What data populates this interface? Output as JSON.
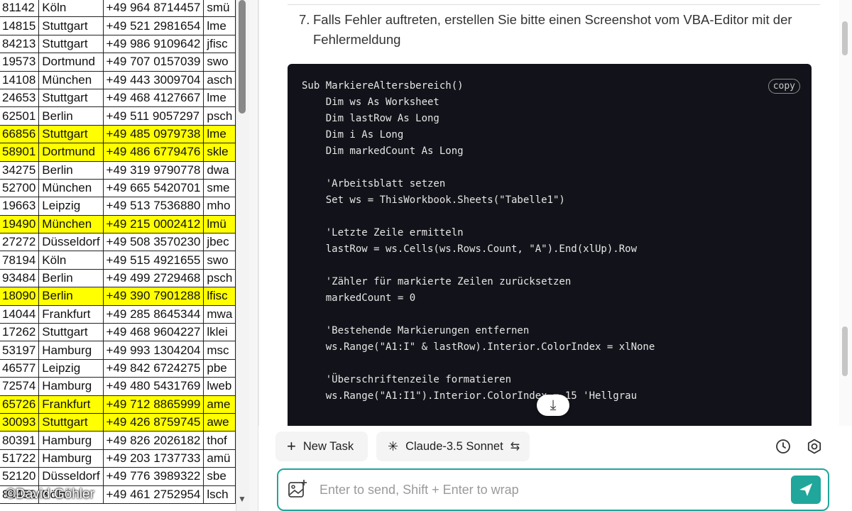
{
  "sheet": {
    "rows": [
      {
        "plz": "81142",
        "city": "Köln",
        "phone": "+49 964 8714457",
        "mail": "smü",
        "highlight": false
      },
      {
        "plz": "14815",
        "city": "Stuttgart",
        "phone": "+49 521 2981654",
        "mail": "lme",
        "highlight": false
      },
      {
        "plz": "84213",
        "city": "Stuttgart",
        "phone": "+49 986 9109642",
        "mail": "jfisc",
        "highlight": false
      },
      {
        "plz": "19573",
        "city": "Dortmund",
        "phone": "+49 707 0157039",
        "mail": "swo",
        "highlight": false
      },
      {
        "plz": "14108",
        "city": "München",
        "phone": "+49 443 3009704",
        "mail": "asch",
        "highlight": false
      },
      {
        "plz": "24653",
        "city": "Stuttgart",
        "phone": "+49 468 4127667",
        "mail": "lme",
        "highlight": false
      },
      {
        "plz": "62501",
        "city": "Berlin",
        "phone": "+49 511 9057297",
        "mail": "psch",
        "highlight": false
      },
      {
        "plz": "66856",
        "city": "Stuttgart",
        "phone": "+49 485 0979738",
        "mail": "lme",
        "highlight": true
      },
      {
        "plz": "58901",
        "city": "Dortmund",
        "phone": "+49 486 6779476",
        "mail": "skle",
        "highlight": true
      },
      {
        "plz": "34275",
        "city": "Berlin",
        "phone": "+49 319 9790778",
        "mail": "dwa",
        "highlight": false
      },
      {
        "plz": "52700",
        "city": "München",
        "phone": "+49 665 5420701",
        "mail": "sme",
        "highlight": false
      },
      {
        "plz": "19663",
        "city": "Leipzig",
        "phone": "+49 513 7536880",
        "mail": "mho",
        "highlight": false
      },
      {
        "plz": "19490",
        "city": "München",
        "phone": "+49 215 0002412",
        "mail": "lmü",
        "highlight": true
      },
      {
        "plz": "27272",
        "city": "Düsseldorf",
        "phone": "+49 508 3570230",
        "mail": "jbec",
        "highlight": false
      },
      {
        "plz": "78194",
        "city": "Köln",
        "phone": "+49 515 4921655",
        "mail": "swo",
        "highlight": false
      },
      {
        "plz": "93484",
        "city": "Berlin",
        "phone": "+49 499 2729468",
        "mail": "psch",
        "highlight": false
      },
      {
        "plz": "18090",
        "city": "Berlin",
        "phone": "+49 390 7901288",
        "mail": "lfisc",
        "highlight": true
      },
      {
        "plz": "14044",
        "city": "Frankfurt",
        "phone": "+49 285 8645344",
        "mail": "mwa",
        "highlight": false
      },
      {
        "plz": "17262",
        "city": "Stuttgart",
        "phone": "+49 468 9604227",
        "mail": "lklei",
        "highlight": false
      },
      {
        "plz": "53197",
        "city": "Hamburg",
        "phone": "+49 993 1304204",
        "mail": "msc",
        "highlight": false
      },
      {
        "plz": "46577",
        "city": "Leipzig",
        "phone": "+49 842 6724275",
        "mail": "pbe",
        "highlight": false
      },
      {
        "plz": "72574",
        "city": "Hamburg",
        "phone": "+49 480 5431769",
        "mail": "lweb",
        "highlight": false
      },
      {
        "plz": "65726",
        "city": "Frankfurt",
        "phone": "+49 712 8865999",
        "mail": "ame",
        "highlight": true
      },
      {
        "plz": "30093",
        "city": "Stuttgart",
        "phone": "+49 426 8759745",
        "mail": "awe",
        "highlight": true
      },
      {
        "plz": "80391",
        "city": "Hamburg",
        "phone": "+49 826 2026182",
        "mail": "thof",
        "highlight": false
      },
      {
        "plz": "51722",
        "city": "Hamburg",
        "phone": "+49 203 1737733",
        "mail": "amü",
        "highlight": false
      },
      {
        "plz": "52120",
        "city": "Düsseldorf",
        "phone": "+49 776 3989322",
        "mail": "sbe",
        "highlight": false
      },
      {
        "plz": "81452",
        "city": "Köln",
        "phone": "+49 461 2752954",
        "mail": "lsch",
        "highlight": false
      }
    ]
  },
  "chat": {
    "step_number": "7.",
    "step_text": "Falls Fehler auftreten, erstellen Sie bitte einen Screenshot vom VBA-Editor mit der Fehlermeldung",
    "copy_label": "copy",
    "code": "Sub MarkiereAltersbereich()\n    Dim ws As Worksheet\n    Dim lastRow As Long\n    Dim i As Long\n    Dim markedCount As Long\n\n    'Arbeitsblatt setzen\n    Set ws = ThisWorkbook.Sheets(\"Tabelle1\")\n\n    'Letzte Zeile ermitteln\n    lastRow = ws.Cells(ws.Rows.Count, \"A\").End(xlUp).Row\n\n    'Zähler für markierte Zeilen zurücksetzen\n    markedCount = 0\n\n    'Bestehende Markierungen entfernen\n    ws.Range(\"A1:I\" & lastRow).Interior.ColorIndex = xlNone\n\n    'Überschriftenzeile formatieren\n    ws.Range(\"A1:I1\").Interior.ColorIndex = 15 'Hellgrau",
    "scroll_down_glyph": "⤓"
  },
  "toolbar": {
    "new_task_label": "New Task",
    "model_label": "Claude-3.5 Sonnet"
  },
  "input": {
    "placeholder": "Enter to send, Shift + Enter to wrap",
    "value": ""
  },
  "watermark": "©David Göhler",
  "colors": {
    "highlight": "#ffff00",
    "accent": "#20a69a",
    "code_bg": "#12131a"
  },
  "icons": {
    "new_task": "plus-icon",
    "model": "sparkle-icon",
    "swap": "swap-icon",
    "history": "clock-icon",
    "settings": "gear-icon",
    "image": "image-add-icon",
    "send": "send-icon",
    "scroll_down": "arrow-down-icon"
  }
}
